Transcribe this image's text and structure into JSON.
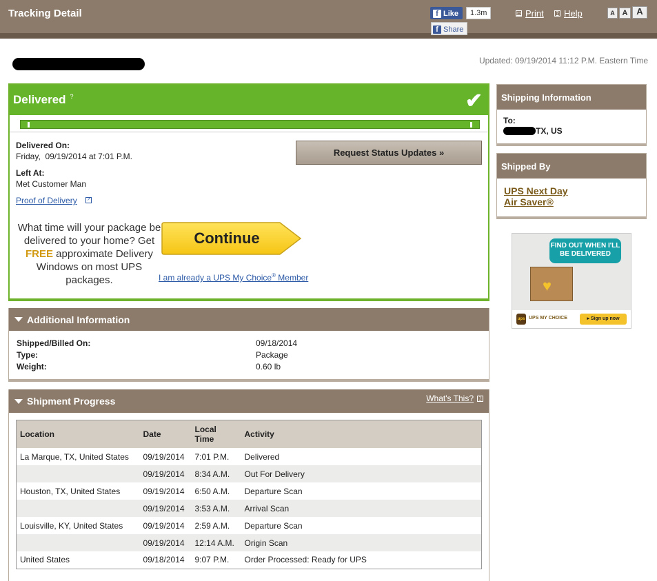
{
  "header": {
    "title": "Tracking Detail",
    "fb_like": "Like",
    "fb_count": "1.3m",
    "fb_share": "Share",
    "print": "Print",
    "help": "Help",
    "font_sizes": [
      "A",
      "A",
      "A"
    ]
  },
  "updated": "Updated: 09/19/2014 11:12 P.M. Eastern Time",
  "status": {
    "title": "Delivered",
    "help_mark": "?",
    "delivered_on_label": "Delivered On:",
    "delivered_on_value": "Friday,  09/19/2014 at 7:01 P.M.",
    "left_at_label": "Left At:",
    "left_at_value": "Met Customer Man",
    "proof_link": "Proof of Delivery",
    "request_button": "Request Status Updates »"
  },
  "promo": {
    "line1": "What time will your package be delivered to your home? Get",
    "free": "FREE",
    "line2": "approximate Delivery Windows on most UPS packages.",
    "continue_label": "Continue",
    "member_link": "I am already a UPS My Choice",
    "member_link_sup": "®",
    "member_link_tail": " Member"
  },
  "additional": {
    "title": "Additional Information",
    "rows": [
      {
        "label": "Shipped/Billed On:",
        "value": "09/18/2014"
      },
      {
        "label": "Type:",
        "value": "Package"
      },
      {
        "label": "Weight:",
        "value": "0.60 lb"
      }
    ]
  },
  "progress": {
    "title": "Shipment Progress",
    "whats_this": "What's This?",
    "columns": [
      "Location",
      "Date",
      "Local Time",
      "Activity"
    ],
    "rows": [
      {
        "location": "La Marque, TX, United States",
        "date": "09/19/2014",
        "time": "7:01 P.M.",
        "activity": "Delivered"
      },
      {
        "location": "",
        "date": "09/19/2014",
        "time": "8:34 A.M.",
        "activity": "Out For Delivery"
      },
      {
        "location": "Houston, TX, United States",
        "date": "09/19/2014",
        "time": "6:50 A.M.",
        "activity": "Departure Scan"
      },
      {
        "location": "",
        "date": "09/19/2014",
        "time": "3:53 A.M.",
        "activity": "Arrival Scan"
      },
      {
        "location": "Louisville, KY, United States",
        "date": "09/19/2014",
        "time": "2:59 A.M.",
        "activity": "Departure Scan"
      },
      {
        "location": "",
        "date": "09/19/2014",
        "time": "12:14 A.M.",
        "activity": "Origin Scan"
      },
      {
        "location": "United States",
        "date": "09/18/2014",
        "time": "9:07 P.M.",
        "activity": "Order Processed: Ready for UPS"
      }
    ]
  },
  "shipping_info": {
    "title": "Shipping Information",
    "to_label": "To:",
    "to_value": "TX, US"
  },
  "shipped_by": {
    "title": "Shipped By",
    "service_line1": "UPS Next Day",
    "service_line2": "Air Saver®"
  },
  "ad": {
    "bubble": "FIND OUT WHEN I'LL BE DELIVERED",
    "brand": "UPS MY CHOICE",
    "signup": "Sign up now"
  },
  "colors": {
    "header_brown": "#8c7b6a",
    "delivered_green": "#66b42a",
    "link_blue": "#2b59a6",
    "free_gold": "#d29a12"
  }
}
